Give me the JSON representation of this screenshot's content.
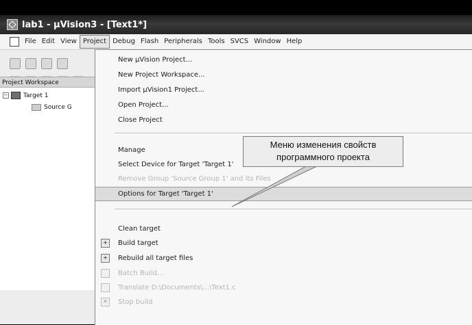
{
  "window": {
    "title": "lab1 - µVision3 - [Text1*]"
  },
  "menubar": {
    "items": [
      "File",
      "Edit",
      "View",
      "Project",
      "Debug",
      "Flash",
      "Peripherals",
      "Tools",
      "SVCS",
      "Window",
      "Help"
    ],
    "open_index": 3
  },
  "workspace": {
    "header": "Project Workspace",
    "tree": [
      {
        "label": "Target 1",
        "expander": "−"
      },
      {
        "label": "Source G"
      }
    ]
  },
  "project_menu": {
    "items": [
      {
        "label": "New µVision Project...",
        "enabled": true
      },
      {
        "label": "New Project Workspace...",
        "enabled": true
      },
      {
        "label": "Import µVision1 Project...",
        "enabled": true
      },
      {
        "label": "Open Project...",
        "enabled": true
      },
      {
        "label": "Close Project",
        "enabled": true
      },
      {
        "label": "Manage",
        "enabled": true
      },
      {
        "label": "Select Device for Target 'Target 1'",
        "enabled": true
      },
      {
        "label": "Remove Group 'Source Group 1' and its Files",
        "enabled": false
      },
      {
        "label": "Options for Target 'Target 1'",
        "enabled": true,
        "highlighted": true
      },
      {
        "label": "Clean target",
        "enabled": true
      },
      {
        "label": "Build target",
        "enabled": true
      },
      {
        "label": "Rebuild all target files",
        "enabled": true
      },
      {
        "label": "Batch Build...",
        "enabled": false
      },
      {
        "label": "Translate D:\\Documents\\...\\Text1.c",
        "enabled": false
      },
      {
        "label": "Stop build",
        "enabled": false
      }
    ]
  },
  "callout": {
    "line1": "Меню изменения свойств",
    "line2": "программного проекта"
  }
}
